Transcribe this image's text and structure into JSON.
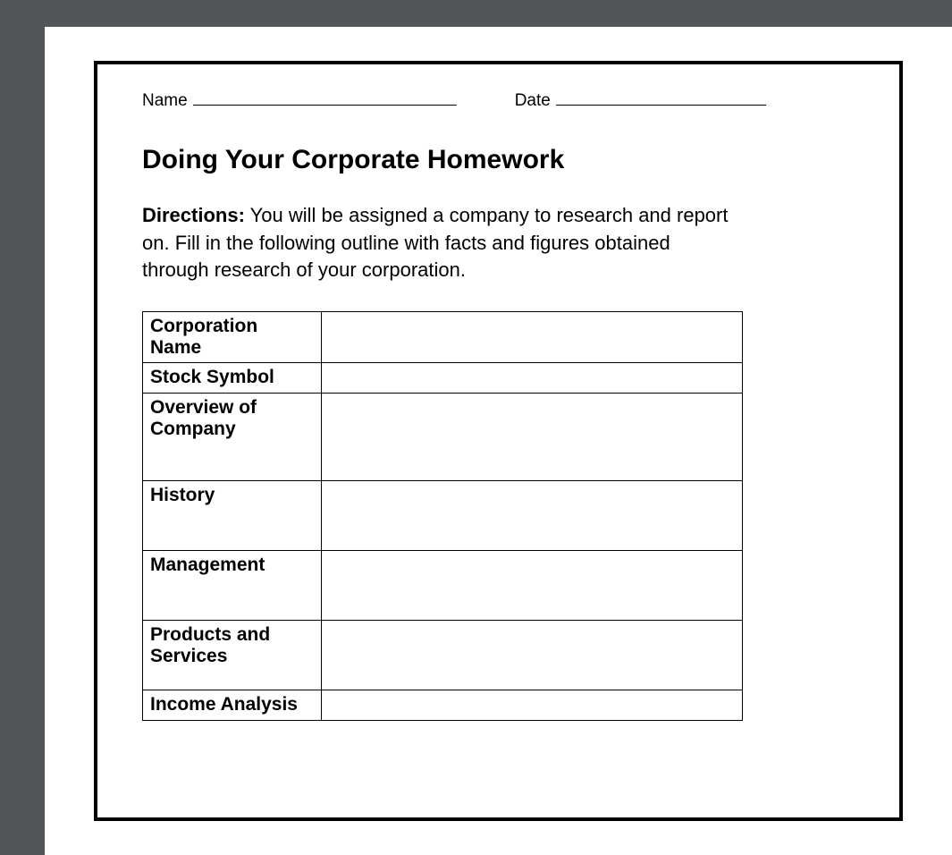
{
  "header": {
    "name_label": "Name",
    "date_label": "Date"
  },
  "title": "Doing Your Corporate Homework",
  "directions": {
    "label": "Directions:",
    "text": " You will be assigned a company to research and report on. Fill in the following outline with facts and figures obtained through research of your corporation."
  },
  "rows": [
    {
      "label": "Corporation Name",
      "value": "",
      "size": "short"
    },
    {
      "label": "Stock Symbol",
      "value": "",
      "size": "short"
    },
    {
      "label": "Overview of Company",
      "value": "",
      "size": "tall"
    },
    {
      "label": "History",
      "value": "",
      "size": "mid"
    },
    {
      "label": "Management",
      "value": "",
      "size": "mid"
    },
    {
      "label": "Products and Services",
      "value": "",
      "size": "mid"
    },
    {
      "label": "Income Analysis",
      "value": "",
      "size": "short"
    }
  ]
}
